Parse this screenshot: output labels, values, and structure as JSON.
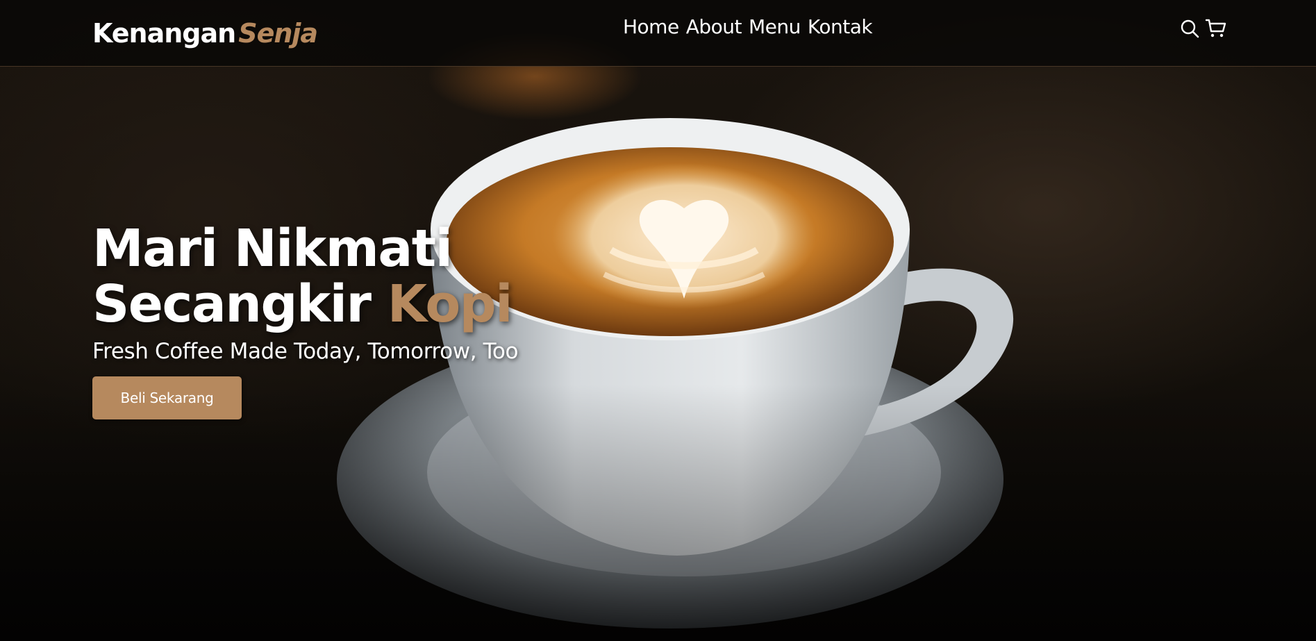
{
  "brand": {
    "name_primary": "Kenangan",
    "name_accent": "Senja",
    "accent_color": "#b6895e"
  },
  "nav": {
    "links": [
      {
        "label": "Home"
      },
      {
        "label": "About"
      },
      {
        "label": "Menu"
      },
      {
        "label": "Kontak"
      }
    ],
    "icons": [
      "search-icon",
      "shopping-cart-icon"
    ]
  },
  "hero": {
    "headline_line1": "Mari Nikmati",
    "headline_line2_plain": "Secangkir",
    "headline_line2_accent": "Kopi",
    "subtitle": "Fresh Coffee Made Today, Tomorrow, Too",
    "cta_label": "Beli Sekarang",
    "background_image": "cup-of-latte-with-heart-art-on-saucer"
  },
  "colors": {
    "accent": "#b6895e",
    "text": "#ffffff",
    "navbar_bg": "#080706"
  }
}
